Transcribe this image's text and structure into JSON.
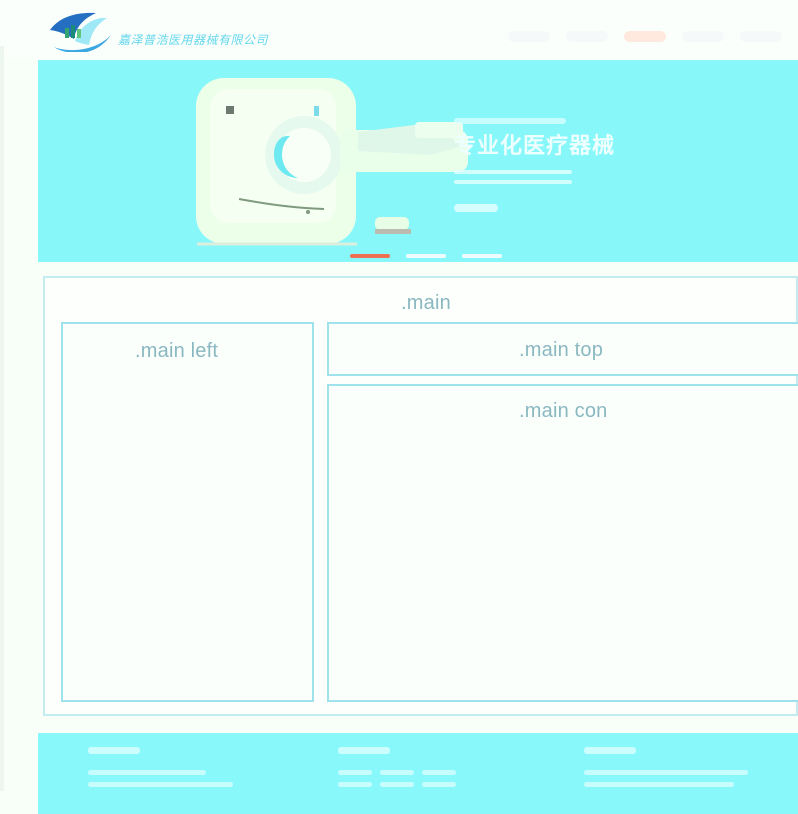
{
  "brand": {
    "name": "嘉泽普浩医用器械有限公司"
  },
  "navigation": {
    "items": [
      {
        "active": false
      },
      {
        "active": false
      },
      {
        "active": true
      },
      {
        "active": false
      },
      {
        "active": false
      }
    ]
  },
  "hero": {
    "title": "专业化医疗器械"
  },
  "layout_labels": {
    "main": ".main",
    "main_left": ".main left",
    "main_top": ".main top",
    "main_con": ".main con"
  },
  "colors": {
    "hero_background": "#87f7fa",
    "footer_background": "#89f8fb",
    "brand_text": "#65d7ec",
    "active_indicator": "#ef6f52",
    "box_border": "#9ee2eb"
  },
  "icons": {
    "logo": "brand-logo-icon",
    "machine": "ct-scanner-illustration"
  }
}
